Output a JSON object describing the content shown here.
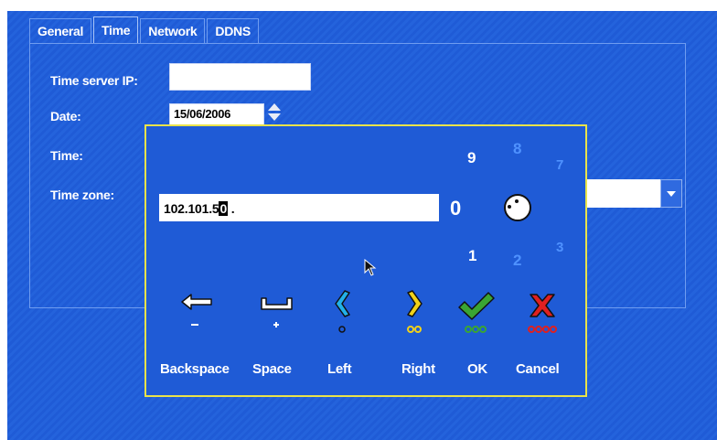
{
  "tabs": [
    {
      "label": "General",
      "active": false
    },
    {
      "label": "Time",
      "active": true
    },
    {
      "label": "Network",
      "active": false
    },
    {
      "label": "DDNS",
      "active": false
    }
  ],
  "form": {
    "time_server_label": "Time server IP:",
    "time_server_value": "",
    "date_label": "Date:",
    "date_value": "15/06/2006",
    "time_label": "Time:",
    "timezone_label": "Time zone:"
  },
  "dialog": {
    "ip_value_prefix": "102.101.5",
    "ip_value_caret": "0",
    "ip_value_suffix": " .",
    "selected_digit": "0",
    "wheel_digits_white": [
      "9",
      "1"
    ],
    "wheel_digits_blue": [
      "8",
      "7",
      "2",
      "3"
    ],
    "buttons": [
      {
        "label": "Backspace",
        "hint": "−",
        "icon": "backspace-arrow-icon"
      },
      {
        "label": "Space",
        "hint": "+",
        "icon": "space-icon"
      },
      {
        "label": "Left",
        "hint": "○",
        "icon": "left-chevron-icon"
      },
      {
        "label": "Right",
        "hint": "○○",
        "icon": "right-chevron-icon"
      },
      {
        "label": "OK",
        "hint": "○○○",
        "icon": "green-check-icon"
      },
      {
        "label": "Cancel",
        "hint": "○○○○",
        "icon": "red-x-icon"
      }
    ]
  },
  "colors": {
    "background": "#1f5bd6",
    "dialog_border": "#e9e34a",
    "wheel_blue": "#4f92ff",
    "ok_green": "#3aa533",
    "cancel_red": "#e02020"
  }
}
